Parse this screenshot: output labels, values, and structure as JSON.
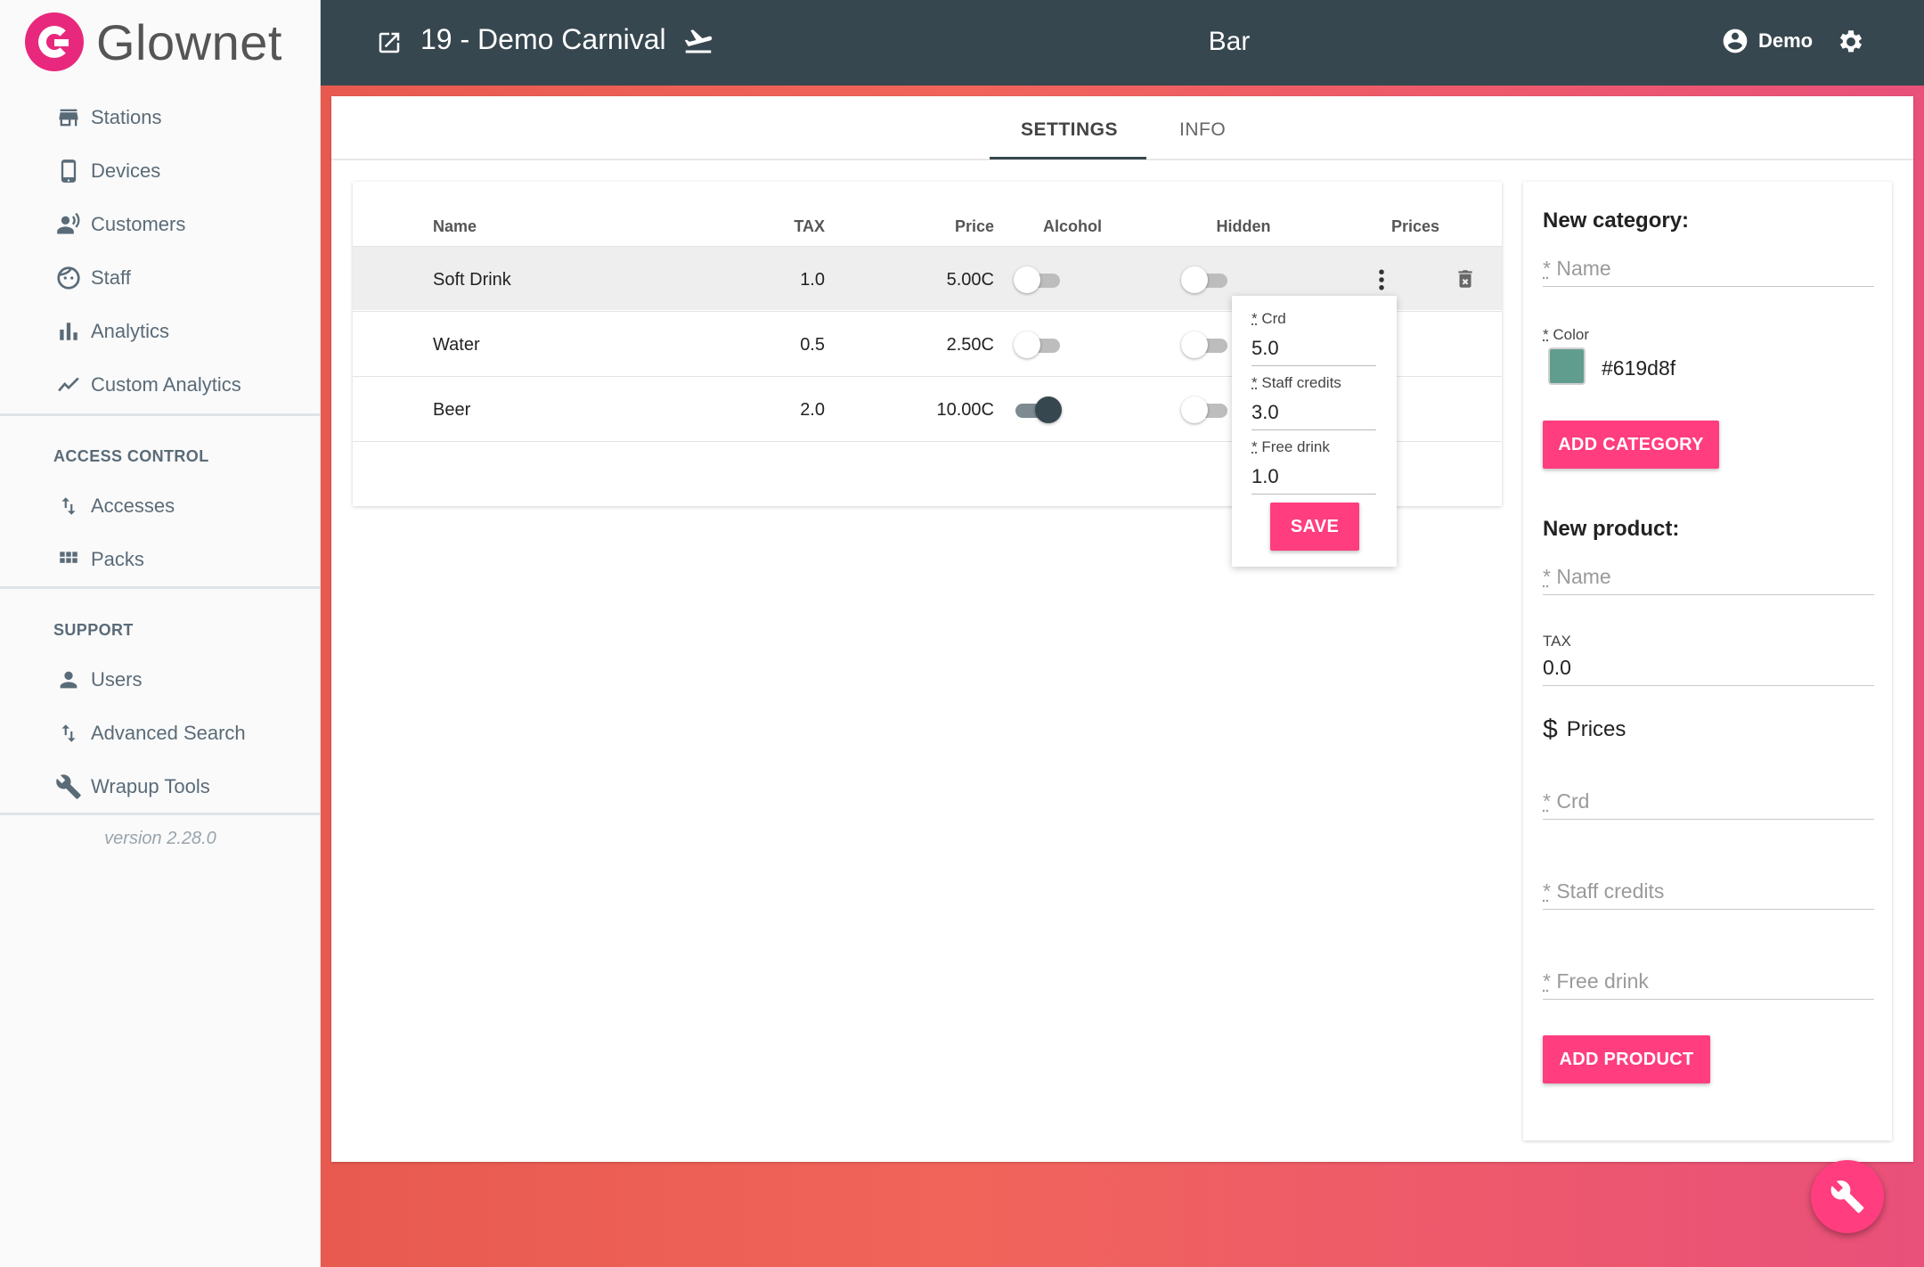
{
  "brand": {
    "name": "Glownet",
    "accent": "#e8287c"
  },
  "sidebar": {
    "items": [
      {
        "label": "Stations",
        "icon": "store-icon"
      },
      {
        "label": "Devices",
        "icon": "phone-icon"
      },
      {
        "label": "Customers",
        "icon": "customers-icon"
      },
      {
        "label": "Staff",
        "icon": "face-icon"
      },
      {
        "label": "Analytics",
        "icon": "bar-chart-icon"
      },
      {
        "label": "Custom Analytics",
        "icon": "trending-icon"
      }
    ],
    "access_control": {
      "title": "ACCESS CONTROL",
      "items": [
        {
          "label": "Accesses",
          "icon": "swap-vert-icon"
        },
        {
          "label": "Packs",
          "icon": "grid-icon"
        }
      ]
    },
    "support": {
      "title": "SUPPORT",
      "items": [
        {
          "label": "Users",
          "icon": "person-icon"
        },
        {
          "label": "Advanced Search",
          "icon": "swap-vert-icon"
        },
        {
          "label": "Wrapup Tools",
          "icon": "wrench-icon"
        }
      ]
    },
    "version": "version 2.28.0"
  },
  "topbar": {
    "event": "19 - Demo Carnival",
    "title": "Bar",
    "user": "Demo"
  },
  "tabs": [
    {
      "label": "SETTINGS",
      "active": true
    },
    {
      "label": "INFO",
      "active": false
    }
  ],
  "table": {
    "headers": {
      "name": "Name",
      "tax": "TAX",
      "price": "Price",
      "alcohol": "Alcohol",
      "hidden": "Hidden",
      "prices": "Prices"
    },
    "rows": [
      {
        "name": "Soft Drink",
        "tax": "1.0",
        "price": "5.00C",
        "alcohol": false,
        "hidden": false
      },
      {
        "name": "Water",
        "tax": "0.5",
        "price": "2.50C",
        "alcohol": false,
        "hidden": false
      },
      {
        "name": "Beer",
        "tax": "2.0",
        "price": "10.00C",
        "alcohol": true,
        "hidden": false
      }
    ]
  },
  "popover": {
    "fields": [
      {
        "label": "Crd",
        "value": "5.0"
      },
      {
        "label": "Staff credits",
        "value": "3.0"
      },
      {
        "label": "Free drink",
        "value": "1.0"
      }
    ],
    "save": "SAVE"
  },
  "form": {
    "new_category": {
      "title": "New category:",
      "name_placeholder": "Name",
      "color_label": "Color",
      "color_value": "#619d8f",
      "button": "ADD CATEGORY"
    },
    "new_product": {
      "title": "New product:",
      "name_placeholder": "Name",
      "tax_label": "TAX",
      "tax_value": "0.0",
      "prices_label": "Prices",
      "crd_placeholder": "Crd",
      "staff_placeholder": "Staff credits",
      "free_placeholder": "Free drink",
      "button": "ADD PRODUCT"
    }
  },
  "colors": {
    "topbar": "#37474f",
    "pink": "#ff3d7f",
    "swatch": "#619d8f"
  }
}
